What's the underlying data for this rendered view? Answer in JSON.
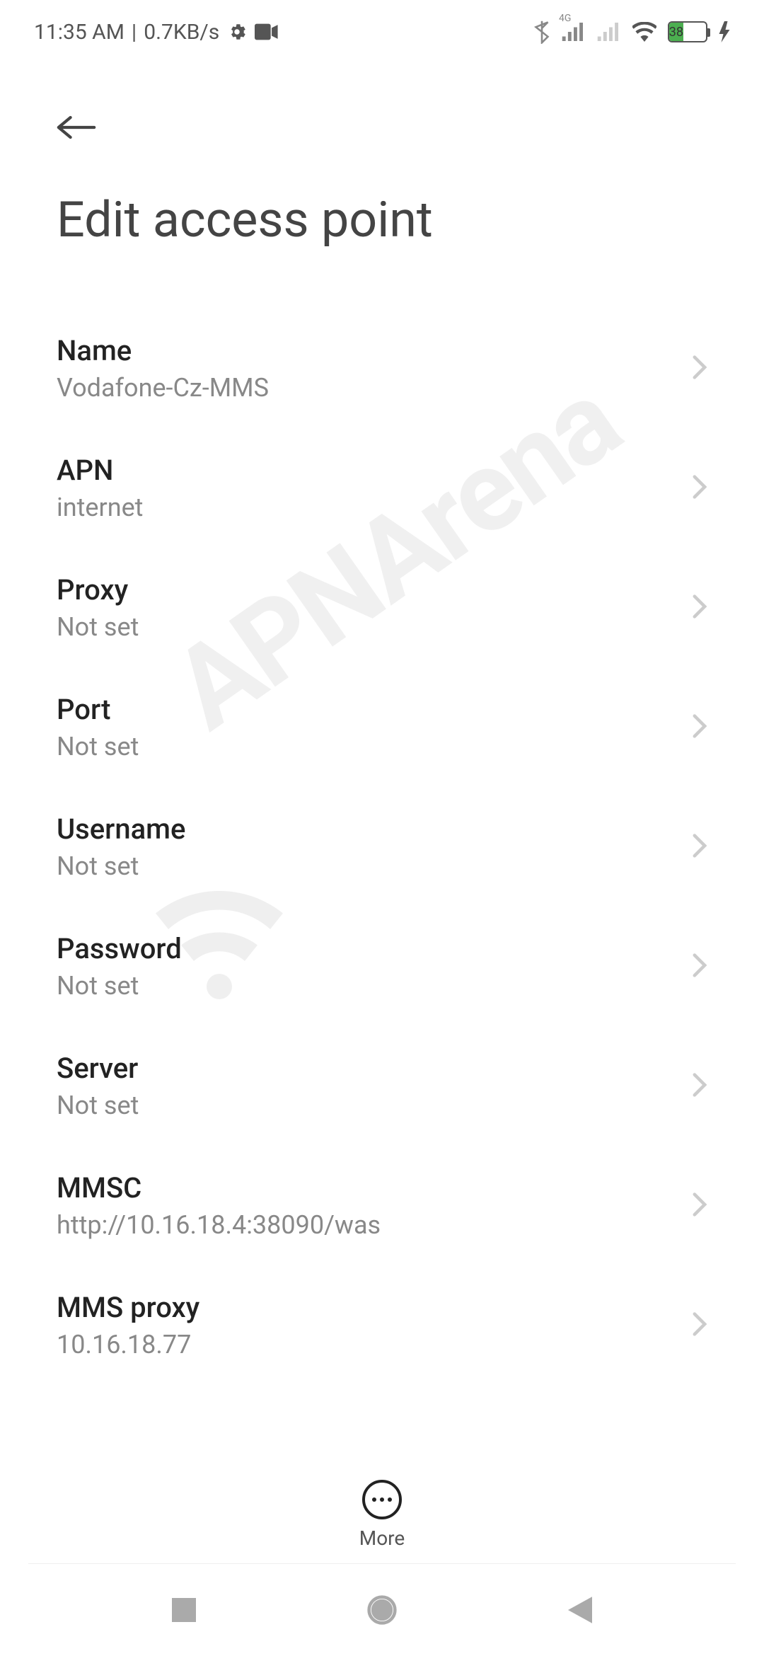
{
  "status": {
    "time": "11:35 AM",
    "speed": "0.7KB/s",
    "battery_text": "38",
    "signal_label": "4G"
  },
  "page": {
    "title": "Edit access point"
  },
  "settings": [
    {
      "label": "Name",
      "value": "Vodafone-Cz-MMS"
    },
    {
      "label": "APN",
      "value": "internet"
    },
    {
      "label": "Proxy",
      "value": "Not set"
    },
    {
      "label": "Port",
      "value": "Not set"
    },
    {
      "label": "Username",
      "value": "Not set"
    },
    {
      "label": "Password",
      "value": "Not set"
    },
    {
      "label": "Server",
      "value": "Not set"
    },
    {
      "label": "MMSC",
      "value": "http://10.16.18.4:38090/was"
    },
    {
      "label": "MMS proxy",
      "value": "10.16.18.77"
    }
  ],
  "bottom_action": {
    "label": "More"
  },
  "watermark": "APNArena"
}
